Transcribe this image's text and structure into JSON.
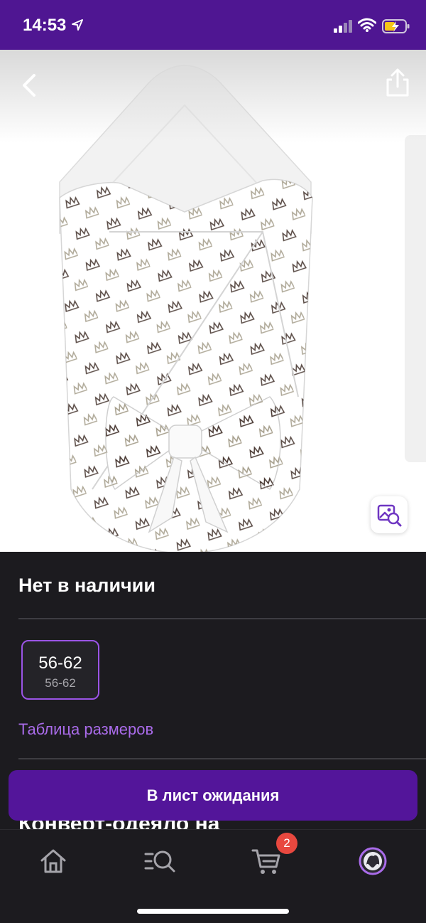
{
  "status_bar": {
    "time": "14:53",
    "icons": [
      "location-arrow-icon",
      "signal-icon",
      "wifi-icon",
      "battery-charging-icon"
    ]
  },
  "gallery": {
    "icons": [
      "back-chevron-icon",
      "share-icon",
      "visual-search-icon"
    ]
  },
  "product": {
    "availability": "Нет в наличии",
    "sizes": [
      {
        "label": "56-62",
        "sublabel": "56-62",
        "selected": true
      }
    ],
    "size_table_link": "Таблица размеров",
    "title_peek": "Конверт-одеяло на"
  },
  "actions": {
    "waitlist_label": "В лист ожидания"
  },
  "tab_bar": {
    "items": [
      "home-icon",
      "catalog-search-icon",
      "cart-icon",
      "profile-avatar-icon"
    ],
    "cart_badge": "2"
  },
  "colors": {
    "brand_purple": "#4f1692",
    "button_purple": "#53159a",
    "link_purple": "#a96be9",
    "background": "#1c1b1f",
    "badge_red": "#e8483f"
  }
}
